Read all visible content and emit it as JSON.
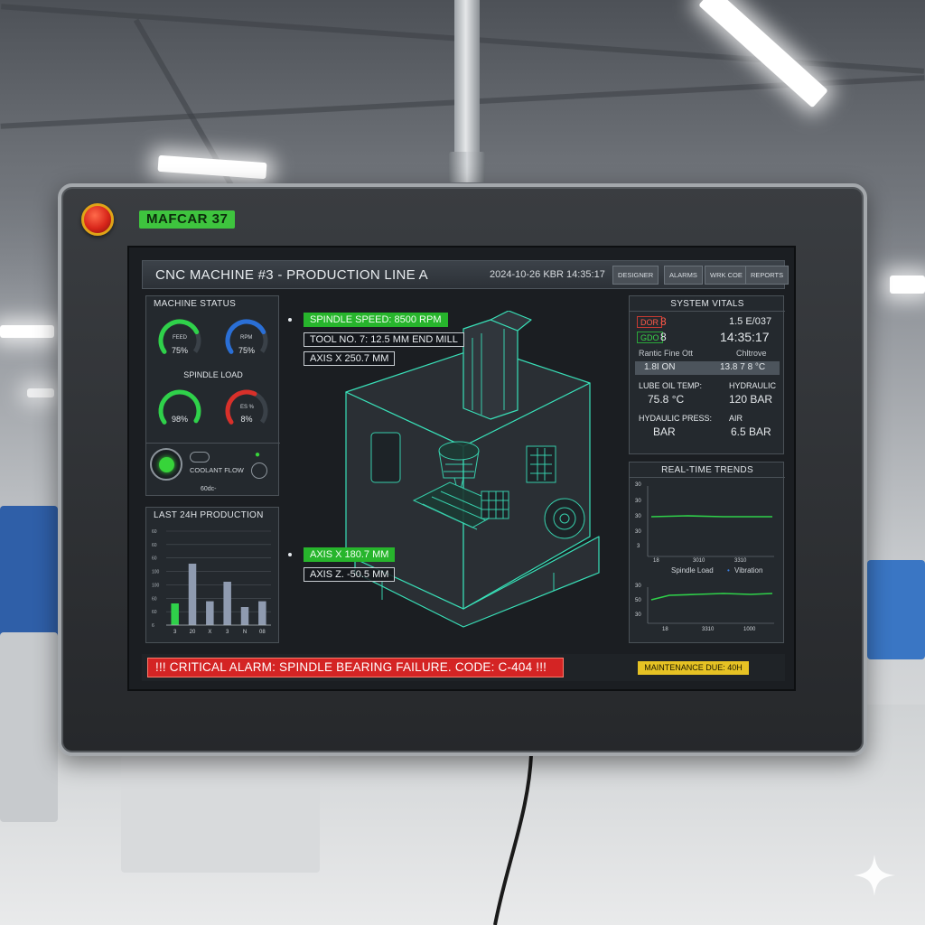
{
  "device": {
    "brand_label": "MAFCAR 37"
  },
  "header": {
    "title": "CNC MACHINE #3 - PRODUCTION LINE A",
    "datetime": "2024-10-26  KBR  14:35:17",
    "nav": [
      "DESIGNER",
      "ALARMS",
      "WRK COE",
      "REPORTS"
    ]
  },
  "machine_status": {
    "title": "MACHINE STATUS",
    "gauges_top": [
      {
        "label": "75%",
        "sub": "FEED",
        "color": "#2fd14a",
        "value": 0.75
      },
      {
        "label": "75%",
        "sub": "RPM",
        "color": "#2a6fd6",
        "value": 0.75
      }
    ],
    "spindle_load_title": "SPINDLE LOAD",
    "gauges_bottom": [
      {
        "label": "98%",
        "sub": "",
        "color": "#2fd14a",
        "value": 0.98
      },
      {
        "label": "8%",
        "sub": "ES %",
        "color": "#d8302a",
        "value": 0.6
      }
    ],
    "coolant_label": "COOLANT FLOW",
    "footer": "60dc-"
  },
  "production": {
    "title": "LAST 24H PRODUCTION",
    "y_ticks": [
      "60",
      "60",
      "60",
      "100",
      "100",
      "60",
      "60",
      "6"
    ],
    "x_ticks": [
      "3",
      "20",
      "X",
      "3",
      "N",
      "08"
    ]
  },
  "callouts": {
    "spindle_speed": "SPINDLE SPEED: 8500 RPM",
    "tool": "TOOL NO. 7: 12.5 MM END MILL",
    "axis_x_top": "AXIS X    250.7 MM",
    "axis_x_bottom": "AXIS X          180.7 MM",
    "axis_z": "AXIS Z.         -50.5 MM"
  },
  "vitals": {
    "title": "SYSTEM VITALS",
    "row1_badge": "DOR",
    "row1_val": "8",
    "row1_right": "1.5 E/037",
    "row2_badge": "GDO",
    "row2_val": "8",
    "row2_right": "14:35:17",
    "row3_left": "Rantic Fine Ott",
    "row3_right": "Chltrove",
    "row4_left": "1.8I ON",
    "row4_right": "13.8 7 8 °C",
    "lube_label": "LUBE OIL TEMP:",
    "lube_value": "75.8 °C",
    "hydraulic_label": "HYDRAULIC",
    "hydraulic_value": "120 BAR",
    "hyd_press_label": "HYDAULIC PRESS:",
    "hyd_press_value": "BAR",
    "air_label": "AIR",
    "air_value": "6.5 BAR"
  },
  "trends": {
    "title": "REAL-TIME TRENDS",
    "top_y": [
      "30",
      "30",
      "30",
      "30",
      "3"
    ],
    "top_x": [
      "18",
      "3010",
      "3310"
    ],
    "legend_spindle": "Spindle Load",
    "legend_vibration": "Vibration",
    "bottom_y": [
      "30",
      "50",
      "30"
    ],
    "bottom_x": [
      "18",
      "3310",
      "1000"
    ]
  },
  "footer": {
    "alarm": "!!! CRITICAL ALARM: SPINDLE BEARING FAILURE. CODE: C-404 !!!",
    "maintenance": "MAINTENANCE DUE: 40H"
  },
  "colors": {
    "accent_green": "#27b52c",
    "alarm_red": "#d42424",
    "warn_yellow": "#e6c224",
    "wireframe": "#39e0b8"
  },
  "chart_data": {
    "type": "bar",
    "title": "LAST 24H PRODUCTION",
    "categories": [
      "3",
      "20",
      "X",
      "3",
      "N",
      "08"
    ],
    "series": [
      {
        "values": [
          30,
          85,
          33,
          60,
          25,
          33
        ]
      }
    ],
    "highlight_first": true,
    "ylim": [
      0,
      130
    ]
  }
}
